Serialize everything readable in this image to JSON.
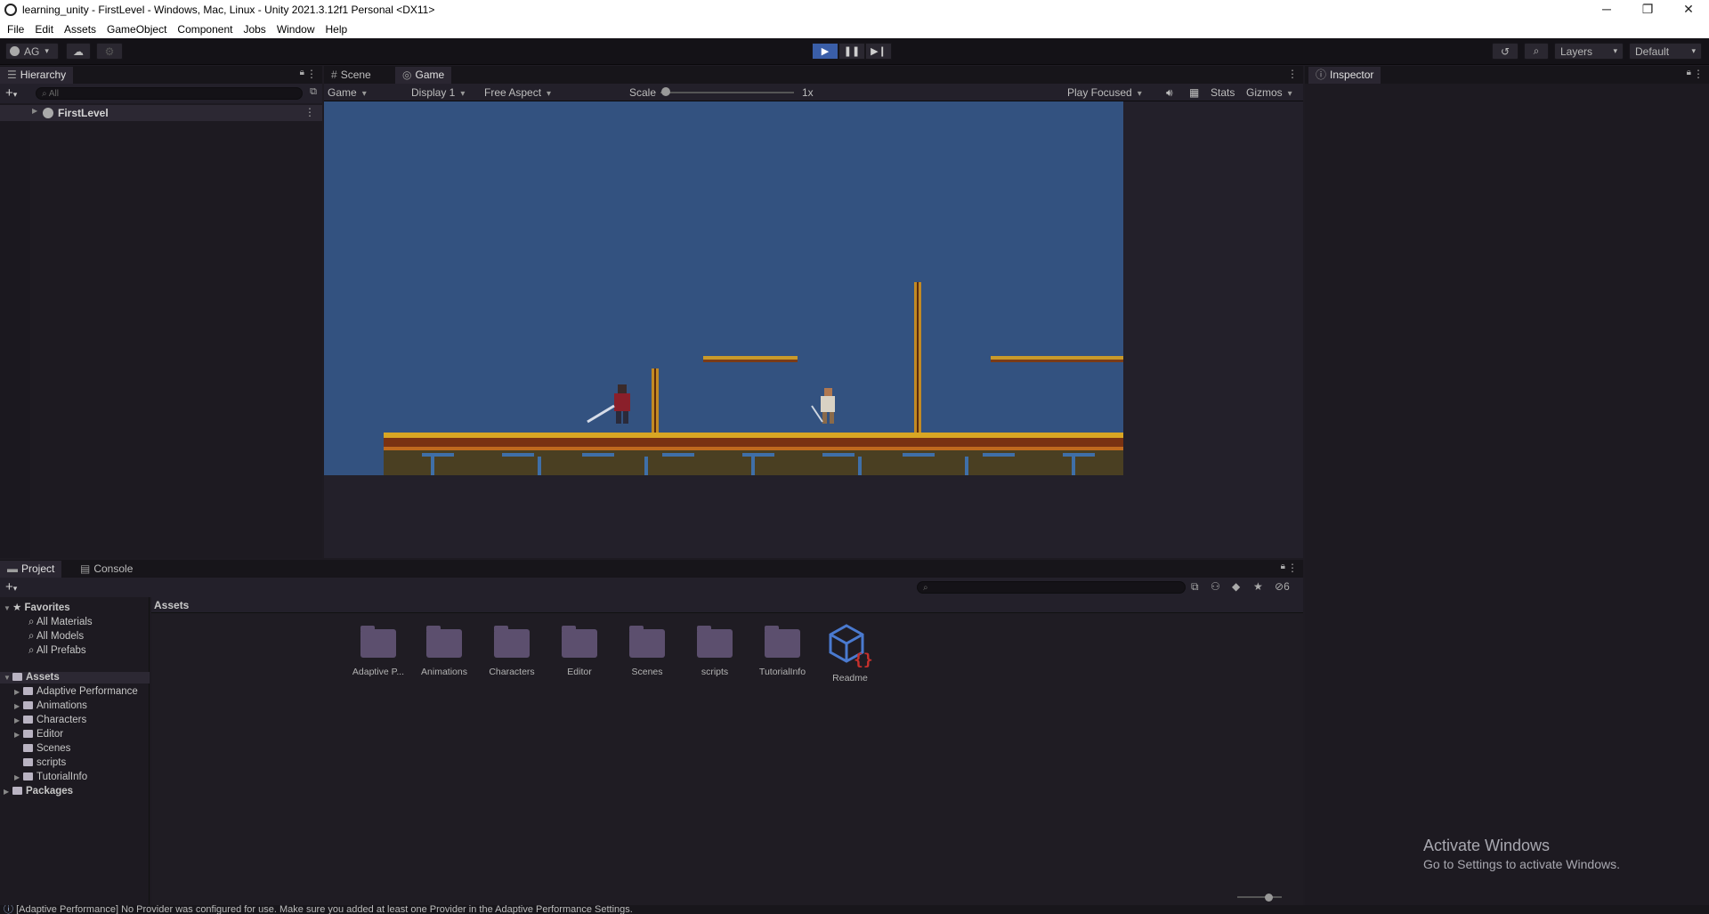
{
  "window": {
    "title": "learning_unity - FirstLevel - Windows, Mac, Linux - Unity 2021.3.12f1 Personal <DX11>",
    "controls": [
      "─",
      "❐",
      "✕"
    ]
  },
  "menu": [
    "File",
    "Edit",
    "Assets",
    "GameObject",
    "Component",
    "Jobs",
    "Window",
    "Help"
  ],
  "toolbar": {
    "account": "AG",
    "layers": "Layers",
    "layout": "Default"
  },
  "hierarchy": {
    "tab": "Hierarchy",
    "search_placeholder": "All",
    "scene": "FirstLevel"
  },
  "center": {
    "tabs": [
      "Scene",
      "Game"
    ],
    "active_tab": "Game",
    "game_toolbar": {
      "mode": "Game",
      "display": "Display 1",
      "aspect": "Free Aspect",
      "scale_label": "Scale",
      "scale_value": "1x",
      "play_focused": "Play Focused",
      "stats": "Stats",
      "gizmos": "Gizmos"
    }
  },
  "inspector": {
    "tab": "Inspector"
  },
  "project": {
    "tabs": [
      "Project",
      "Console"
    ],
    "hidden_count": "6",
    "favorites": {
      "label": "Favorites",
      "items": [
        "All Materials",
        "All Models",
        "All Prefabs"
      ]
    },
    "assets_root": "Assets",
    "asset_tree": [
      "Adaptive Performance",
      "Animations",
      "Characters",
      "Editor",
      "Scenes",
      "scripts",
      "TutorialInfo"
    ],
    "packages": "Packages",
    "breadcrumb": "Assets",
    "grid": [
      "Adaptive P...",
      "Animations",
      "Characters",
      "Editor",
      "Scenes",
      "scripts",
      "TutorialInfo",
      "Readme"
    ]
  },
  "status": {
    "message": "[Adaptive Performance] No Provider was configured for use. Make sure you added at least one Provider in the Adaptive Performance Settings."
  },
  "watermark": {
    "line1": "Activate Windows",
    "line2": "Go to Settings to activate Windows."
  },
  "colors": {
    "sky": "#335280",
    "play_active": "#3a5ea8",
    "panel": "#1d1a21"
  }
}
